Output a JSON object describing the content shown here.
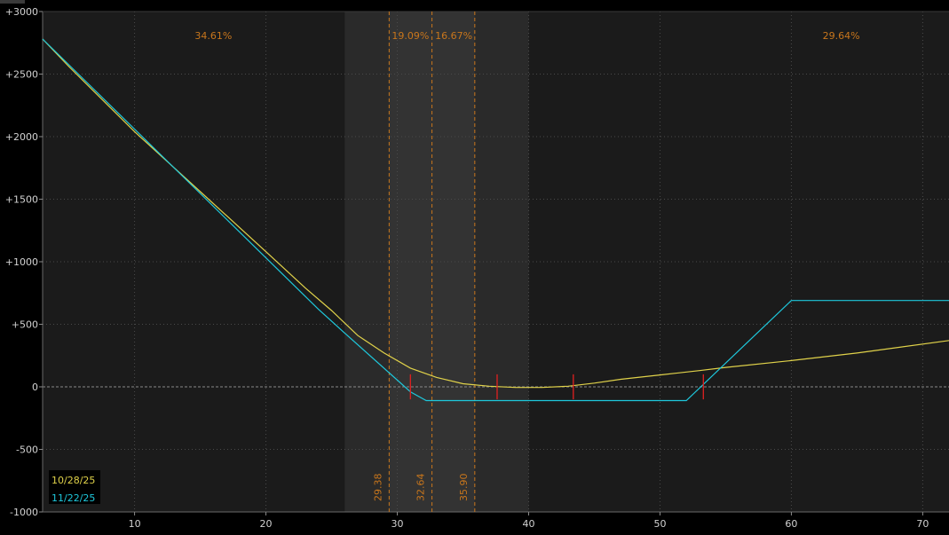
{
  "chart_data": {
    "type": "line",
    "xlim": [
      3,
      72
    ],
    "ylim": [
      -1000,
      3000
    ],
    "x_ticks": [
      10,
      20,
      30,
      40,
      50,
      60,
      70
    ],
    "y_ticks": [
      {
        "value": 3000,
        "label": "+3000"
      },
      {
        "value": 2500,
        "label": "+2500"
      },
      {
        "value": 2000,
        "label": "+2000"
      },
      {
        "value": 1500,
        "label": "+1500"
      },
      {
        "value": 1000,
        "label": "+1000"
      },
      {
        "value": 500,
        "label": "+500"
      },
      {
        "value": 0,
        "label": "0"
      },
      {
        "value": -500,
        "label": "-500"
      },
      {
        "value": -1000,
        "label": "-1000"
      }
    ],
    "grid": true,
    "shaded_band": {
      "x0": 26,
      "x1": 40,
      "color": "#2a2a2a"
    },
    "shaded_band_inner": {
      "x0": 29.38,
      "x1": 35.9,
      "color": "#333333"
    },
    "vlines": [
      {
        "x": 29.38,
        "label": "29.38"
      },
      {
        "x": 32.64,
        "label": "32.64"
      },
      {
        "x": 35.9,
        "label": "35.90"
      }
    ],
    "region_pcts": [
      {
        "x": 16,
        "label": "34.61%"
      },
      {
        "x": 31,
        "label": "19.09%"
      },
      {
        "x": 34.3,
        "label": "16.67%"
      },
      {
        "x": 63.8,
        "label": "29.64%"
      }
    ],
    "markers": [
      31,
      37.6,
      43.4,
      53.3
    ],
    "series": [
      {
        "name": "10/28/25",
        "color": "#e0d24a",
        "x": [
          3,
          5,
          10,
          15,
          20,
          23,
          25,
          27,
          29,
          31,
          33,
          35,
          37,
          39,
          41,
          43,
          45,
          47,
          50,
          53,
          55,
          60,
          65,
          72
        ],
        "y": [
          2780,
          2560,
          2040,
          1560,
          1080,
          790,
          610,
          410,
          270,
          150,
          75,
          25,
          5,
          -5,
          -5,
          5,
          30,
          60,
          95,
          130,
          155,
          210,
          270,
          370
        ]
      },
      {
        "name": "11/22/25",
        "color": "#1ec8dc",
        "x": [
          3,
          24,
          26,
          31,
          32.2,
          52,
          60,
          72
        ],
        "y": [
          2780,
          620,
          430,
          -40,
          -110,
          -110,
          690,
          690
        ]
      }
    ]
  }
}
